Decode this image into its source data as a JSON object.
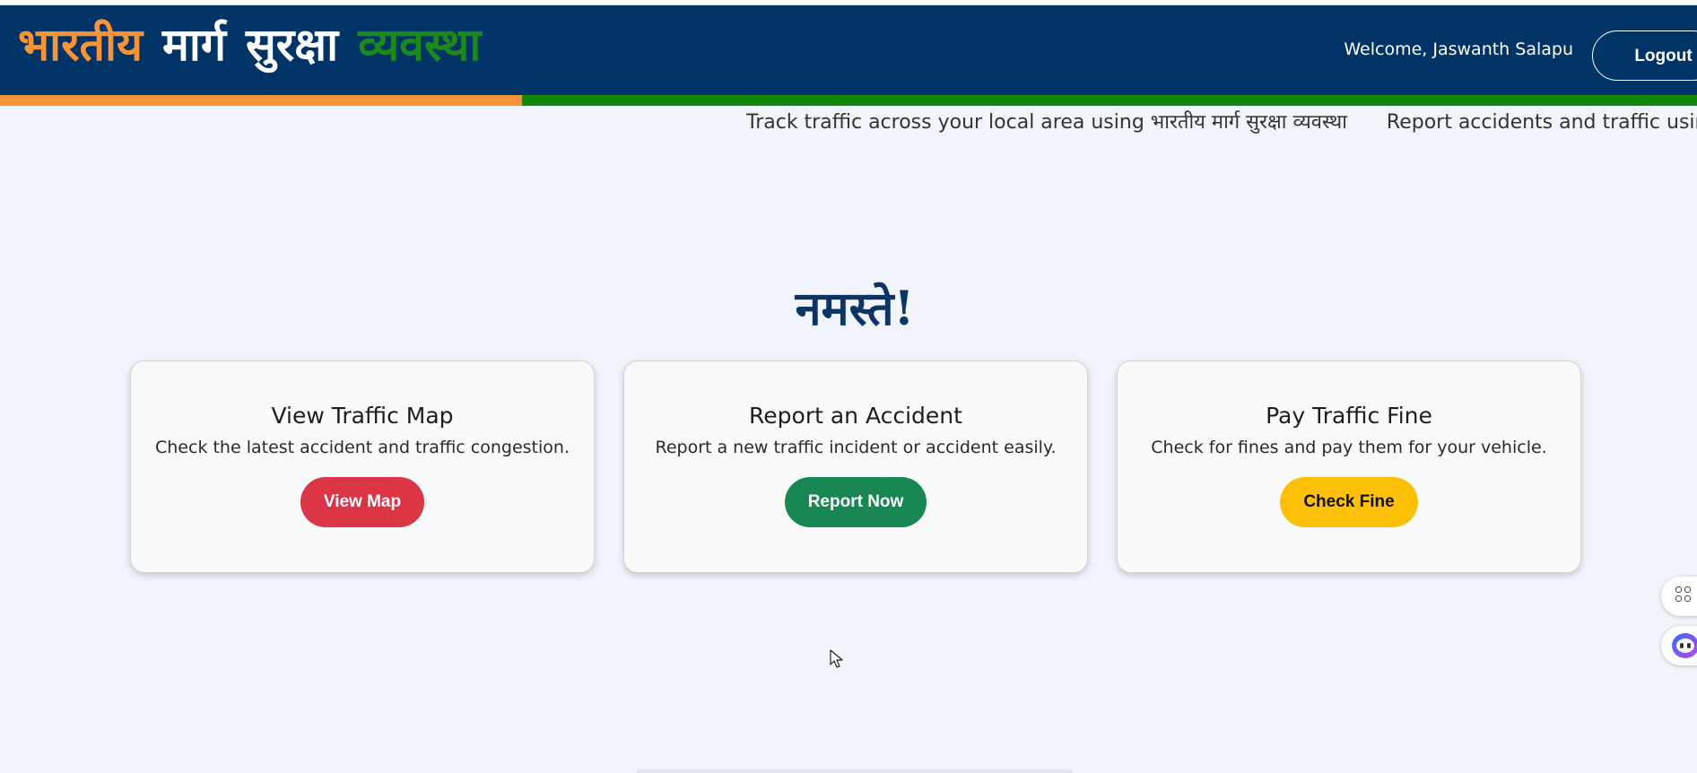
{
  "header": {
    "brand_words": [
      "भारतीय",
      "मार्ग",
      "सुरक्षा",
      "व्यवस्था"
    ],
    "welcome_text": "Welcome, Jaswanth Salapu",
    "logout_label": "Logout",
    "colors": {
      "background": "#003366",
      "saffron": "#f7943a",
      "green": "#138808"
    }
  },
  "ticker": {
    "messages": [
      "Track traffic across your local area using भारतीय मार्ग सुरक्षा व्यवस्था",
      "Report accidents and traffic using भारतीय मार्ग सुरक्षा व्यवस्था"
    ]
  },
  "main": {
    "greeting": "नमस्ते!",
    "cards": [
      {
        "title": "View Traffic Map",
        "description": "Check the latest accident and traffic congestion.",
        "button_label": "View Map",
        "button_color": "#dc3545"
      },
      {
        "title": "Report an Accident",
        "description": "Report a new traffic incident or accident easily.",
        "button_label": "Report Now",
        "button_color": "#198754"
      },
      {
        "title": "Pay Traffic Fine",
        "description": "Check for fines and pay them for your vehicle.",
        "button_label": "Check Fine",
        "button_color": "#ffc107"
      }
    ]
  },
  "side_widgets": {
    "icons": [
      "apps-grid-icon",
      "assistant-bot-icon"
    ]
  }
}
